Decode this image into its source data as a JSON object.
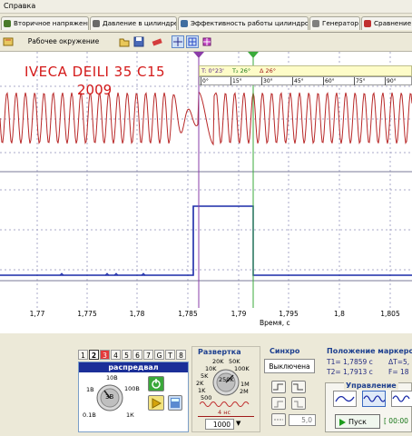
{
  "menu": {
    "help": "Справка"
  },
  "tabs": [
    {
      "label": "Вторичное напряжение",
      "icon": "secondary-voltage-icon"
    },
    {
      "label": "Давление в цилиндре",
      "icon": "cylinder-pressure-icon"
    },
    {
      "label": "Эффективность работы цилиндров",
      "icon": "cylinder-efficiency-icon"
    },
    {
      "label": "Генератор",
      "icon": "generator-icon"
    },
    {
      "label": "Сравнение",
      "icon": "comparison-icon"
    }
  ],
  "toolbar": {
    "environment": "Рабочее окружение"
  },
  "plot": {
    "title_line1": "IVECA   DEILI 35 C15",
    "title_line2": "2009",
    "markers": {
      "t1_angle": "0°23'",
      "t2_angle": "26°",
      "delta_angle": "26°"
    },
    "degree_ticks": [
      "0°",
      "15°",
      "30°",
      "45°",
      "60°",
      "75°",
      "90°"
    ],
    "x_ticks": [
      "1,77",
      "1,775",
      "1,78",
      "1,785",
      "1,79",
      "1,795",
      "1,8",
      "1,805"
    ],
    "x_label": "Время, с"
  },
  "channels": {
    "numbers": [
      "1",
      "2",
      "3",
      "4",
      "5",
      "6",
      "7",
      "8"
    ],
    "selected": "2",
    "name": "распредвал",
    "volt_labels": [
      "10В",
      "1В",
      "100В",
      "0.1В",
      "1К"
    ],
    "volt_value": "3В"
  },
  "sweep": {
    "title": "Развертка",
    "labels": [
      "20K",
      "50K",
      "10K",
      "100K",
      "5K",
      "250K",
      "2K",
      "1M",
      "1K",
      "2M",
      "500"
    ],
    "knob_value": "250K",
    "time_per_div": "4 нс",
    "points": "1000"
  },
  "sync": {
    "title": "Синхро",
    "mode": "Выключена",
    "level": "5,0"
  },
  "marker_position": {
    "title": "Положение маркеров",
    "t1": "T1= 1,7859 с",
    "t2": "T2= 1,7913 с",
    "dt": "ΔT=5,",
    "f": "F= 18"
  },
  "control": {
    "title": "Управление",
    "start": "Пуск",
    "timer": "[ 00:00"
  },
  "colors": {
    "signal1": "#b82828",
    "signal2": "#1a2aa8",
    "marker1": "#8a3ca8",
    "marker2": "#3aaa3a",
    "channel_header": "#1b2f98"
  }
}
